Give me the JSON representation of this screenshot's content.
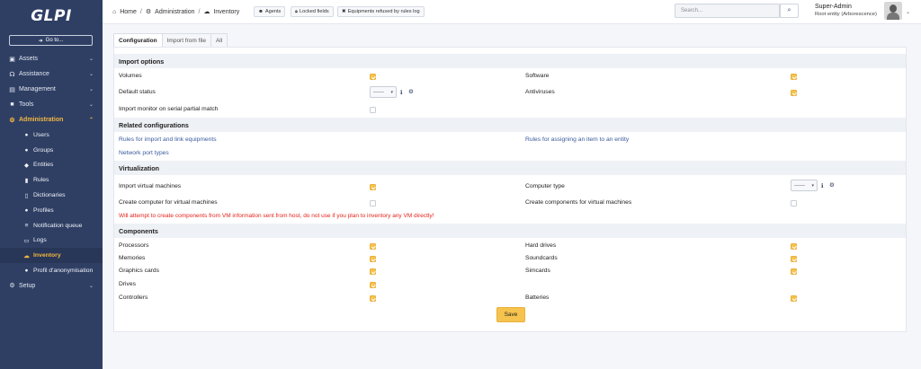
{
  "brand": {
    "logo": "GLPI"
  },
  "sidebar": {
    "goto_label": "Go to...",
    "menus": [
      {
        "label": "Assets",
        "icon": "boxes-icon"
      },
      {
        "label": "Assistance",
        "icon": "headset-icon"
      },
      {
        "label": "Management",
        "icon": "wallet-icon"
      },
      {
        "label": "Tools",
        "icon": "briefcase-icon"
      },
      {
        "label": "Administration",
        "icon": "user-cog-icon"
      }
    ],
    "admin_items": [
      {
        "label": "Users",
        "icon": "user-icon"
      },
      {
        "label": "Groups",
        "icon": "users-icon"
      },
      {
        "label": "Entities",
        "icon": "layers-icon"
      },
      {
        "label": "Rules",
        "icon": "book-icon"
      },
      {
        "label": "Dictionaries",
        "icon": "book-open-icon"
      },
      {
        "label": "Profiles",
        "icon": "user-check-icon"
      },
      {
        "label": "Notification queue",
        "icon": "list-icon"
      },
      {
        "label": "Logs",
        "icon": "file-icon"
      },
      {
        "label": "Inventory",
        "icon": "cloud-download-icon"
      },
      {
        "label": "Profil d'anonymisation",
        "icon": "user-secret-icon"
      }
    ],
    "setup": {
      "label": "Setup",
      "icon": "cogs-icon"
    }
  },
  "topbar": {
    "breadcrumbs": [
      "Home",
      "Administration",
      "Inventory"
    ],
    "chips": [
      "Agents",
      "Locked fields",
      "Equipments refused by rules log"
    ],
    "search_placeholder": "Search...",
    "user_name": "Super-Admin",
    "user_entity": "Root entity (Arborescence)"
  },
  "tabs": [
    "Configuration",
    "Import from file",
    "All"
  ],
  "sections": {
    "import_options": "Import options",
    "related": "Related configurations",
    "virtualization": "Virtualization",
    "components": "Components"
  },
  "import_options": {
    "volumes": {
      "label": "Volumes",
      "checked": true
    },
    "software": {
      "label": "Software",
      "checked": true
    },
    "default_status": {
      "label": "Default status",
      "value": "------"
    },
    "antiviruses": {
      "label": "Antiviruses",
      "checked": true
    },
    "monitor_partial": {
      "label": "Import monitor on serial partial match",
      "checked": false
    }
  },
  "related": {
    "rules_import": "Rules for import and link equipments",
    "rules_assign": "Rules for assigning an item to an entity",
    "network_port_types": "Network port types"
  },
  "virtualization": {
    "import_vm": {
      "label": "Import virtual machines",
      "checked": true
    },
    "computer_type": {
      "label": "Computer type",
      "value": "------"
    },
    "create_computer": {
      "label": "Create computer for virtual machines",
      "checked": false
    },
    "create_components": {
      "label": "Create components for virtual machines",
      "checked": false
    },
    "warning": "Will attempt to create components from VM information sent from host, do not use if you plan to inventory any VM directly!"
  },
  "components": {
    "processors": {
      "label": "Processors",
      "checked": true
    },
    "hard_drives": {
      "label": "Hard drives",
      "checked": true
    },
    "memories": {
      "label": "Memories",
      "checked": true
    },
    "soundcards": {
      "label": "Soundcards",
      "checked": true
    },
    "graphics_cards": {
      "label": "Graphics cards",
      "checked": true
    },
    "simcards": {
      "label": "Simcards",
      "checked": true
    },
    "drives": {
      "label": "Drives",
      "checked": true
    },
    "controllers": {
      "label": "Controllers",
      "checked": true
    },
    "batteries": {
      "label": "Batteries",
      "checked": true
    }
  },
  "actions": {
    "save_label": "Save"
  },
  "colors": {
    "sidebar": "#2f3f64",
    "accent": "#f5c34e",
    "warning": "#e3231b",
    "link": "#3a5a9c"
  }
}
